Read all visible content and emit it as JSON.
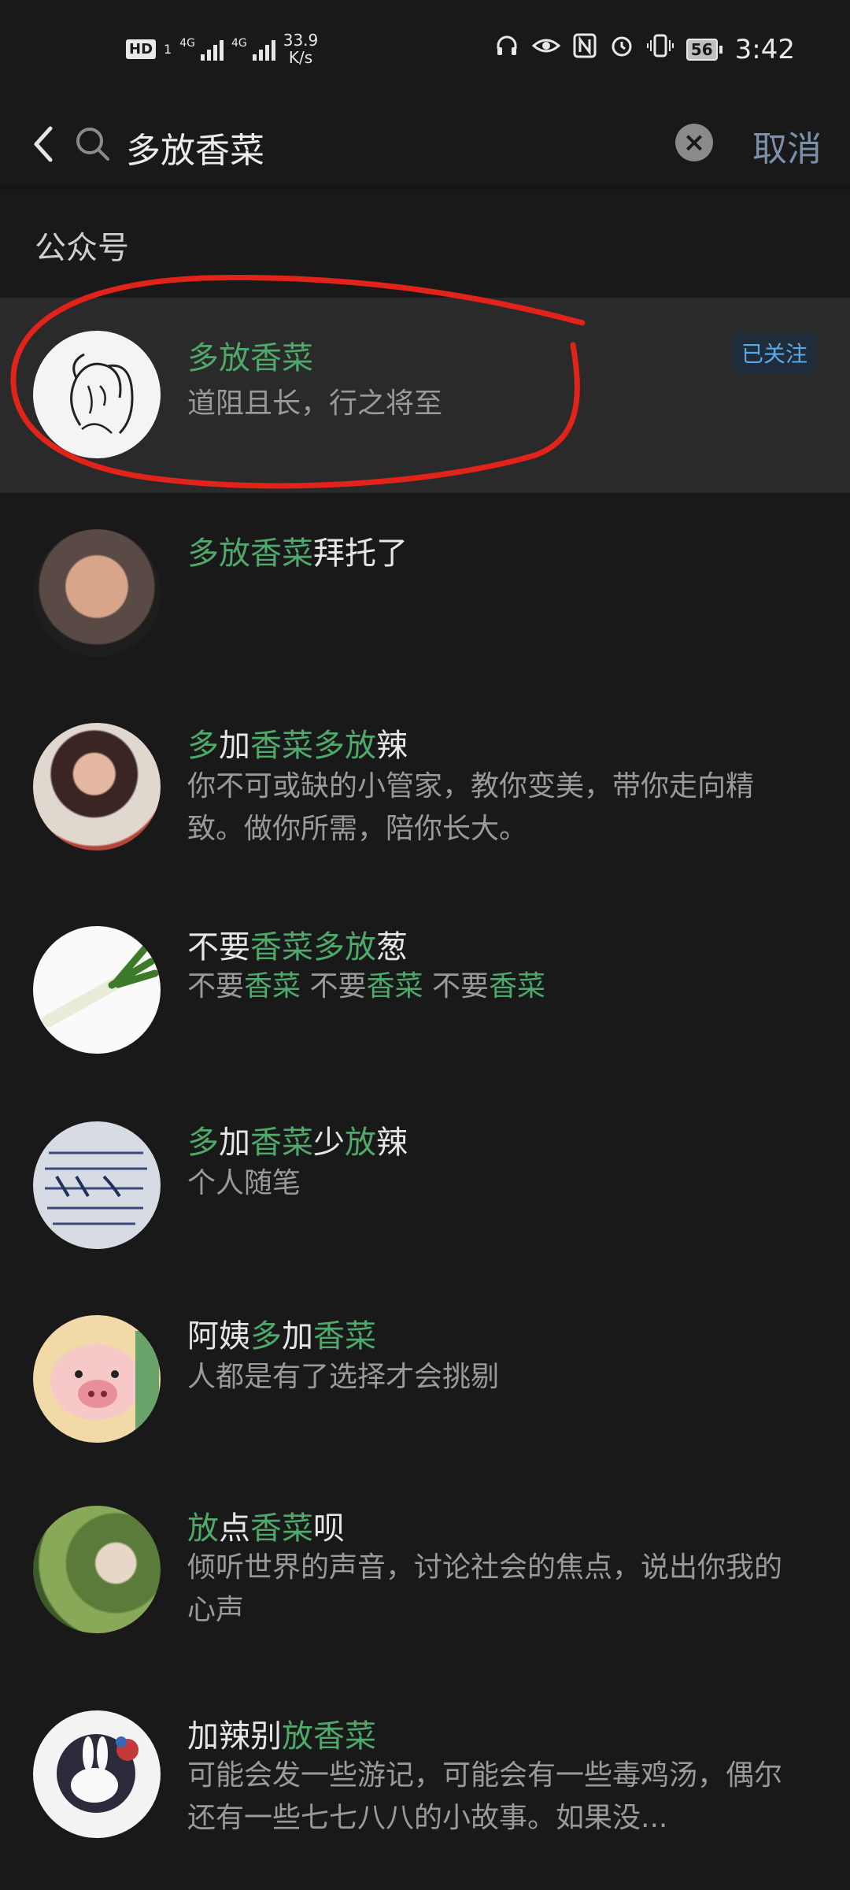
{
  "status_bar": {
    "hd": "HD",
    "sim1": "1",
    "net1": "4G",
    "net2": "4G",
    "speed_value": "33.9",
    "speed_unit": "K/s",
    "battery": "56",
    "time": "3:42"
  },
  "search": {
    "query": "多放香菜",
    "cancel_label": "取消"
  },
  "section": {
    "title": "公众号"
  },
  "results": [
    {
      "title_segments": [
        {
          "t": "多放香菜",
          "h": true
        }
      ],
      "desc_segments": [
        {
          "t": "道阻且长，行之将至",
          "h": false
        }
      ],
      "badge": "已关注"
    },
    {
      "title_segments": [
        {
          "t": "多放香菜",
          "h": true
        },
        {
          "t": "拜托了",
          "h": false
        }
      ],
      "desc_segments": []
    },
    {
      "title_segments": [
        {
          "t": "多",
          "h": true
        },
        {
          "t": "加",
          "h": false
        },
        {
          "t": "香菜",
          "h": true
        },
        {
          "t": "多放",
          "h": true
        },
        {
          "t": "辣",
          "h": false
        }
      ],
      "desc_segments": [
        {
          "t": "你不可或缺的小管家，教你变美，带你走向精致。做你所需，陪你长大。",
          "h": false
        }
      ]
    },
    {
      "title_segments": [
        {
          "t": "不要",
          "h": false
        },
        {
          "t": "香菜",
          "h": true
        },
        {
          "t": "多放",
          "h": true
        },
        {
          "t": "葱",
          "h": false
        }
      ],
      "desc_segments": [
        {
          "t": "不要",
          "h": false
        },
        {
          "t": "香菜",
          "h": true
        },
        {
          "t": " 不要",
          "h": false
        },
        {
          "t": "香菜",
          "h": true
        },
        {
          "t": " 不要",
          "h": false
        },
        {
          "t": "香菜",
          "h": true
        }
      ]
    },
    {
      "title_segments": [
        {
          "t": "多",
          "h": true
        },
        {
          "t": "加",
          "h": false
        },
        {
          "t": "香菜",
          "h": true
        },
        {
          "t": "少",
          "h": false
        },
        {
          "t": "放",
          "h": true
        },
        {
          "t": "辣",
          "h": false
        }
      ],
      "desc_segments": [
        {
          "t": "个人随笔",
          "h": false
        }
      ]
    },
    {
      "title_segments": [
        {
          "t": "阿姨",
          "h": false
        },
        {
          "t": "多",
          "h": true
        },
        {
          "t": "加",
          "h": false
        },
        {
          "t": "香菜",
          "h": true
        }
      ],
      "desc_segments": [
        {
          "t": "人都是有了选择才会挑剔",
          "h": false
        }
      ]
    },
    {
      "title_segments": [
        {
          "t": "放",
          "h": true
        },
        {
          "t": "点",
          "h": false
        },
        {
          "t": "香菜",
          "h": true
        },
        {
          "t": "呗",
          "h": false
        }
      ],
      "desc_segments": [
        {
          "t": "倾听世界的声音，讨论社会的焦点，说出你我的心声",
          "h": false
        }
      ]
    },
    {
      "title_segments": [
        {
          "t": "加辣别",
          "h": false
        },
        {
          "t": "放香菜",
          "h": true
        }
      ],
      "desc_segments": [
        {
          "t": "可能会发一些游记，可能会有一些毒鸡汤，偶尔还有一些七七八八的小故事。如果没...",
          "h": false
        }
      ]
    }
  ],
  "colors": {
    "background": "#191919",
    "highlight_text": "#4fa96a",
    "cancel": "#7d90a9",
    "badge": "#5aa8e8",
    "annotation_circle": "#e2231a"
  },
  "icons": [
    "back-arrow-icon",
    "search-icon",
    "clear-icon"
  ]
}
